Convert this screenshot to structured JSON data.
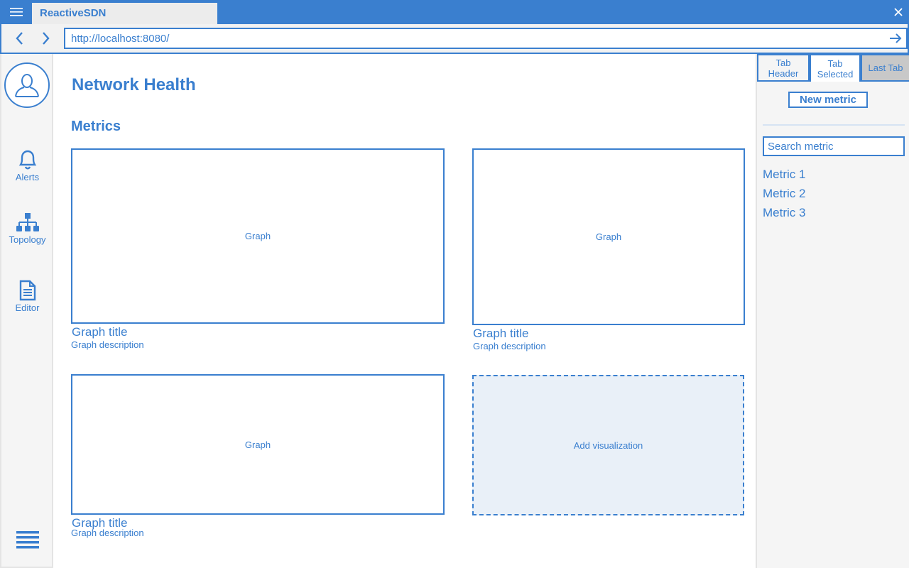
{
  "app": {
    "title": "ReactiveSDN"
  },
  "address": {
    "url": "http://localhost:8080/"
  },
  "sidebar": {
    "items": [
      {
        "label": "Alerts",
        "icon": "bell-icon"
      },
      {
        "label": "Topology",
        "icon": "topology-icon"
      },
      {
        "label": "Editor",
        "icon": "document-icon"
      }
    ]
  },
  "main": {
    "page_title": "Network Health",
    "section_title": "Metrics",
    "graphs": [
      {
        "placeholder": "Graph",
        "title": "Graph title",
        "description": "Graph description"
      },
      {
        "placeholder": "Graph",
        "title": "Graph title",
        "description": "Graph description"
      },
      {
        "placeholder": "Graph",
        "title": "Graph title",
        "description": "Graph description"
      }
    ],
    "add_visualization": "Add visualization"
  },
  "right_panel": {
    "tabs": [
      {
        "label": "Tab Header"
      },
      {
        "label": "Tab Selected"
      },
      {
        "label": "Last Tab"
      }
    ],
    "new_metric_label": "New metric",
    "search_placeholder": "Search metric",
    "metrics": [
      "Metric 1",
      "Metric 2",
      "Metric 3"
    ]
  },
  "colors": {
    "accent": "#3a7fcf",
    "panel": "#f5f5f5",
    "add_bg": "#e9f0f8"
  }
}
